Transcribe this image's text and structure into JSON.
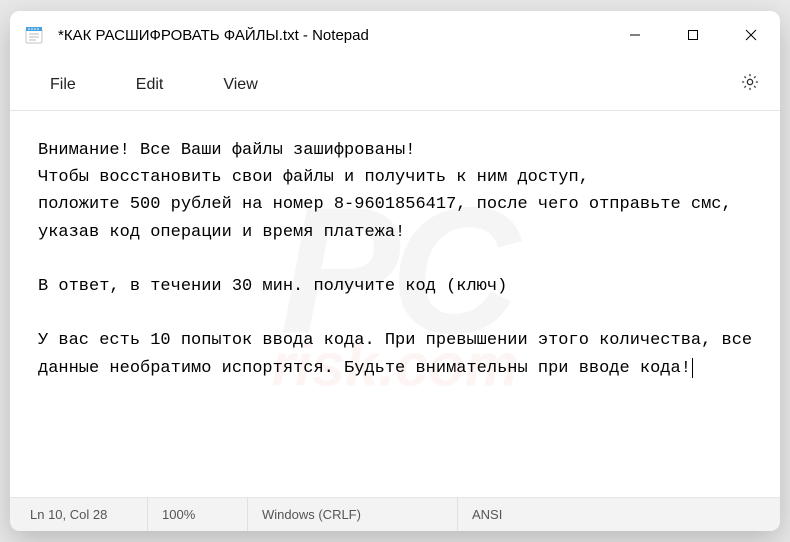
{
  "window": {
    "title": "*КАК РАСШИФРОВАТЬ ФАЙЛЫ.txt - Notepad"
  },
  "menu": {
    "file": "File",
    "edit": "Edit",
    "view": "View"
  },
  "content": {
    "text": "Внимание! Все Ваши файлы зашифрованы!\nЧтобы восстановить свои файлы и получить к ним доступ,\nположите 500 рублей на номер 8-9601856417, после чего отправьте смс, указав код операции и время платежа!\n\nВ ответ, в течении 30 мин. получите код (ключ)\n\nУ вас есть 10 попыток ввода кода. При превышении этого количества, все данные необратимо испортятся. Будьте внимательны при вводе кода!"
  },
  "status": {
    "position": "Ln 10, Col 28",
    "zoom": "100%",
    "eol": "Windows (CRLF)",
    "encoding": "ANSI"
  }
}
